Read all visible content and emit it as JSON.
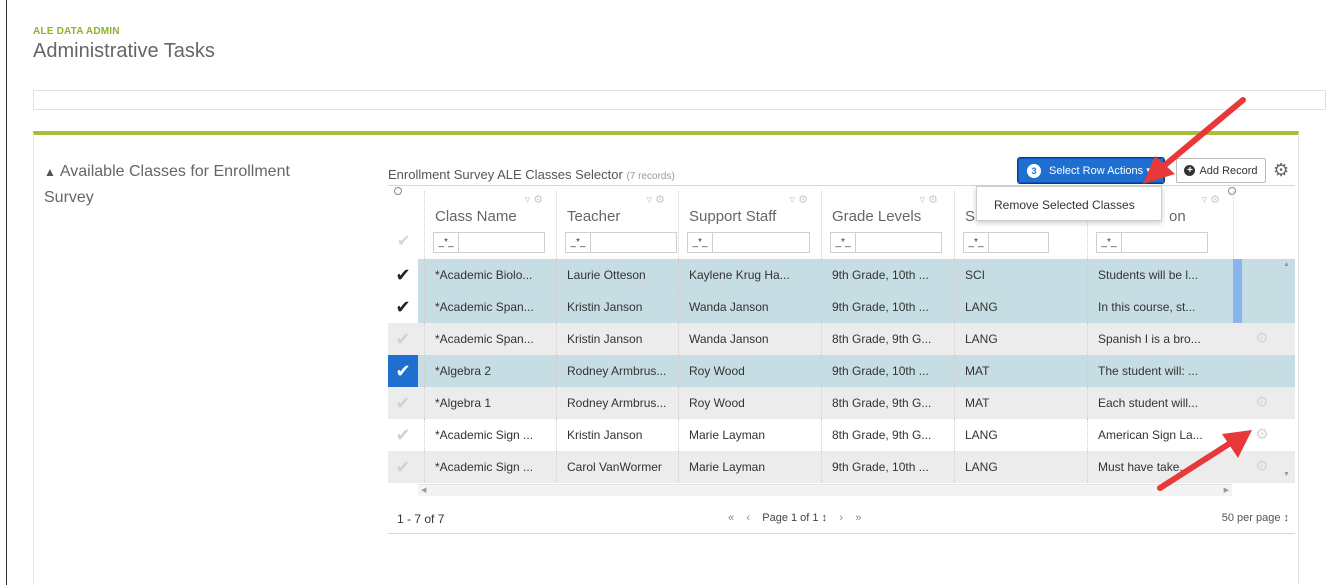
{
  "header": {
    "app_name": "ALE DATA ADMIN",
    "page_title": "Administrative Tasks"
  },
  "section": {
    "title": "Available Classes for Enrollment Survey",
    "caret_icon": "chevron-up-icon"
  },
  "grid": {
    "title": "Enrollment Survey ALE Classes Selector",
    "record_count": "(7 records)",
    "actions_badge": "3",
    "actions_label": "Select Row Actions ▾",
    "add_record_label": "Add Record",
    "menu_item": "Remove Selected Classes",
    "columns": [
      {
        "label": "Class Name",
        "filter": "_*_"
      },
      {
        "label": "Teacher",
        "filter": "_*_"
      },
      {
        "label": "Support Staff",
        "filter": "_*_"
      },
      {
        "label": "Grade Levels",
        "filter": "_*_"
      },
      {
        "label": "Su",
        "filter": "_*_"
      },
      {
        "label": "on",
        "filter": "_*_"
      }
    ],
    "rows": [
      {
        "state": "selected",
        "class_name": "*Academic Biolo...",
        "teacher": "Laurie Otteson",
        "support": "Kaylene Krug Ha...",
        "grades": "9th Grade, 10th ...",
        "subject": "SCI",
        "description": "Students will be l..."
      },
      {
        "state": "selected",
        "class_name": "*Academic Span...",
        "teacher": "Kristin Janson",
        "support": "Wanda Janson",
        "grades": "9th Grade, 10th ...",
        "subject": "LANG",
        "description": "In this course, st..."
      },
      {
        "state": "unselected",
        "class_name": "*Academic Span...",
        "teacher": "Kristin Janson",
        "support": "Wanda Janson",
        "grades": "8th Grade, 9th G...",
        "subject": "LANG",
        "description": "Spanish I is a bro..."
      },
      {
        "state": "active",
        "class_name": "*Algebra 2",
        "teacher": "Rodney Armbrus...",
        "support": "Roy Wood",
        "grades": "9th Grade, 10th ...",
        "subject": "MAT",
        "description": "The student will: ..."
      },
      {
        "state": "unselected",
        "class_name": "*Algebra 1",
        "teacher": "Rodney Armbrus...",
        "support": "Roy Wood",
        "grades": "8th Grade, 9th G...",
        "subject": "MAT",
        "description": "Each student will..."
      },
      {
        "state": "unselected",
        "class_name": "*Academic Sign ...",
        "teacher": "Kristin Janson",
        "support": "Marie Layman",
        "grades": "8th Grade, 9th G...",
        "subject": "LANG",
        "description": "American Sign La..."
      },
      {
        "state": "unselected",
        "class_name": "*Academic Sign ...",
        "teacher": "Carol VanWormer",
        "support": "Marie Layman",
        "grades": "9th Grade, 10th ...",
        "subject": "LANG",
        "description": "Must have take..."
      }
    ]
  },
  "footer": {
    "range": "1 - 7 of 7",
    "first": "«",
    "prev": "‹",
    "page": "Page 1 of 1 ↕",
    "next": "›",
    "last": "»",
    "per_page": "50 per page ↕"
  },
  "colors": {
    "accent_green": "#a8bd3a",
    "brand_label": "#8cb32a",
    "primary_blue": "#1f6fd1",
    "selected_row": "#c6dde3",
    "annotation_red": "#e8383a"
  }
}
